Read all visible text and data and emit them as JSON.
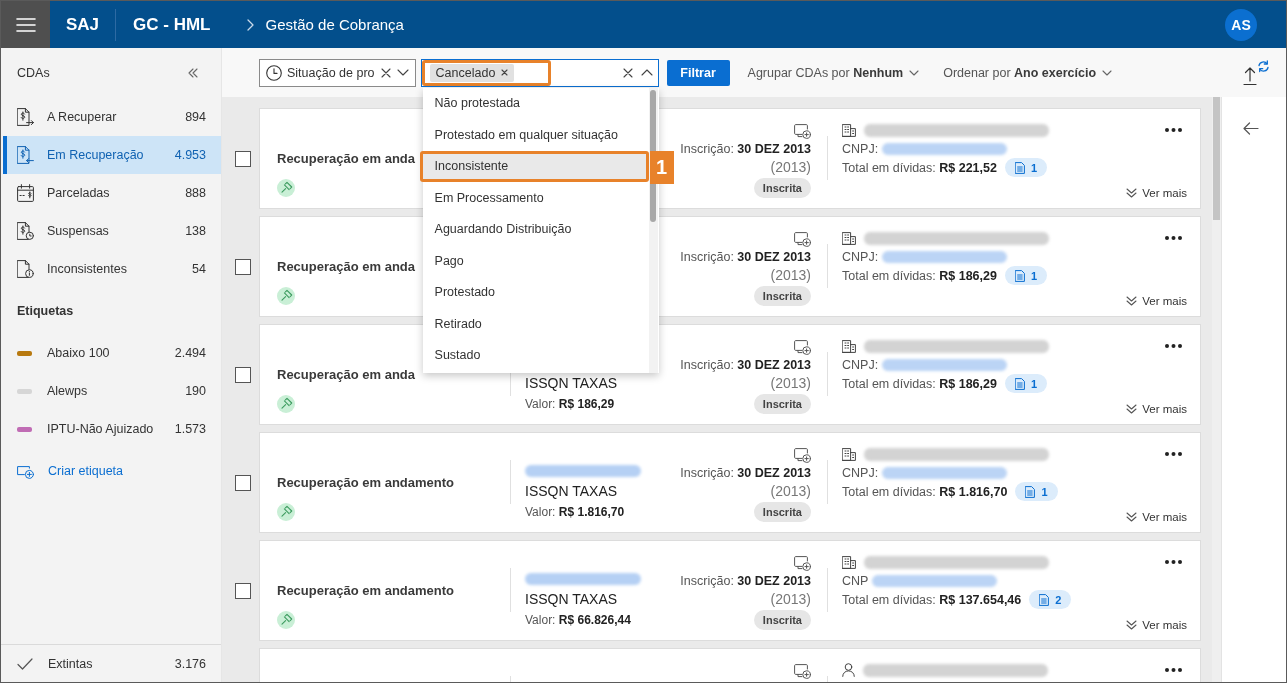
{
  "app_bar": {
    "product": "SAJ",
    "module": "GC - HML",
    "breadcrumb": "Gestão de Cobrança",
    "user_initials": "AS"
  },
  "sidebar": {
    "title": "CDAs",
    "items": [
      {
        "kind": "pending",
        "label": "A Recuperar",
        "count": "894",
        "selected": false
      },
      {
        "kind": "recovering",
        "label": "Em Recuperação",
        "count": "4.953",
        "selected": true
      },
      {
        "kind": "installment",
        "label": "Parceladas",
        "count": "888",
        "selected": false
      },
      {
        "kind": "suspended",
        "label": "Suspensas",
        "count": "138",
        "selected": false
      },
      {
        "kind": "inconsistent",
        "label": "Inconsistentes",
        "count": "54",
        "selected": false
      }
    ],
    "tags_title": "Etiquetas",
    "tags": [
      {
        "label": "Abaixo 100",
        "count": "2.494",
        "color": "#b8790f"
      },
      {
        "label": "Alewps",
        "count": "190",
        "color": "#d6d6d6"
      },
      {
        "label": "IPTU-Não Ajuizado",
        "count": "1.573",
        "color": "#c06cb4"
      }
    ],
    "create_tag": "Criar etiqueta",
    "footer": {
      "label": "Extintas",
      "count": "3.176"
    }
  },
  "filters": {
    "status_field": {
      "value": "Situação de pro"
    },
    "value_field": {
      "focused": true,
      "expanded": true,
      "chips": [
        {
          "label": "Cancelado",
          "highlighted": true
        }
      ],
      "options": [
        {
          "label": "Não protestada",
          "hovered": false,
          "highlighted": false
        },
        {
          "label": "Protestado em qualquer situação",
          "hovered": false,
          "highlighted": false
        },
        {
          "label": "Inconsistente",
          "hovered": true,
          "highlighted": true,
          "step": "1"
        },
        {
          "label": "Em Processamento",
          "hovered": false,
          "highlighted": false
        },
        {
          "label": "Aguardando Distribuição",
          "hovered": false,
          "highlighted": false
        },
        {
          "label": "Pago",
          "hovered": false,
          "highlighted": false
        },
        {
          "label": "Protestado",
          "hovered": false,
          "highlighted": false
        },
        {
          "label": "Retirado",
          "hovered": false,
          "highlighted": false
        },
        {
          "label": "Sustado",
          "hovered": false,
          "highlighted": false
        }
      ]
    },
    "filter_button": "Filtrar",
    "group_by": "Agrupar CDAs por **Nenhum**",
    "order_by": "Ordenar por **Ano exercício**"
  },
  "cards": [
    {
      "kind": "company",
      "checked": false,
      "title": "Recuperação em anda",
      "inscription": "Inscrição: **30 DEZ 2013**",
      "year": "(2013)",
      "status": "Inscrita",
      "id_label": "CNPJ:",
      "total": "Total em dívidas: **R$ 221,52**",
      "documents": "1",
      "see_more": "Ver mais"
    },
    {
      "kind": "company",
      "checked": false,
      "title": "Recuperação em anda",
      "inscription": "Inscrição: **30 DEZ 2013**",
      "year": "(2013)",
      "status": "Inscrita",
      "id_label": "CNPJ:",
      "total": "Total em dívidas: **R$ 186,29**",
      "documents": "1",
      "see_more": "Ver mais"
    },
    {
      "kind": "company",
      "checked": false,
      "title": "Recuperação em anda",
      "tax": "ISSQN TAXAS",
      "value": "Valor: **R$ 186,29**",
      "inscription": "Inscrição: **30 DEZ 2013**",
      "year": "(2013)",
      "status": "Inscrita",
      "id_label": "CNPJ:",
      "total": "Total em dívidas: **R$ 186,29**",
      "documents": "1",
      "see_more": "Ver mais"
    },
    {
      "kind": "company",
      "checked": false,
      "title": "Recuperação em andamento",
      "code_redacted": true,
      "tax": "ISSQN TAXAS",
      "value": "Valor: **R$ 1.816,70**",
      "inscription": "Inscrição: **30 DEZ 2013**",
      "year": "(2013)",
      "status": "Inscrita",
      "id_label": "CNPJ:",
      "total": "Total em dívidas: **R$ 1.816,70**",
      "documents": "1",
      "see_more": "Ver mais"
    },
    {
      "kind": "company",
      "checked": false,
      "title": "Recuperação em andamento",
      "code_redacted": true,
      "tax": "ISSQN TAXAS",
      "value": "Valor: **R$ 66.826,44**",
      "inscription": "Inscrição: **30 DEZ 2013**",
      "year": "(2013)",
      "status": "Inscrita",
      "id_label": "CNP",
      "total": "Total em dívidas: **R$ 137.654,46**",
      "documents": "2",
      "see_more": "Ver mais"
    },
    {
      "kind": "person"
    }
  ]
}
